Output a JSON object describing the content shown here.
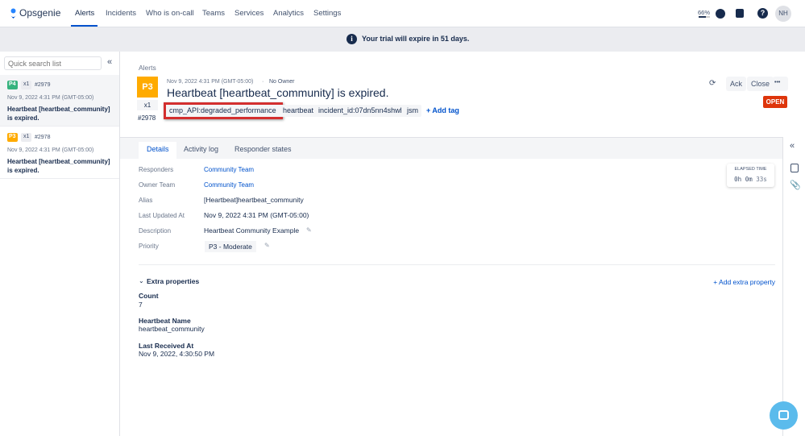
{
  "nav": {
    "brand": "Opsgenie",
    "items": [
      "Alerts",
      "Incidents",
      "Who is on-call",
      "Teams",
      "Services",
      "Analytics",
      "Settings"
    ],
    "progress_label": "66%",
    "avatar": "NH"
  },
  "banner": {
    "text": "Your trial will expire in 51 days."
  },
  "sidebar": {
    "search_placeholder": "Quick search list",
    "items": [
      {
        "priority": "P4",
        "count": "x1",
        "number": "#2979",
        "time": "Nov 9, 2022 4:31 PM (GMT-05:00)",
        "title": "Heartbeat [heartbeat_community] is expired.",
        "color": "#36b37e"
      },
      {
        "priority": "P3",
        "count": "x1",
        "number": "#2978",
        "time": "Nov 9, 2022 4:31 PM (GMT-05:00)",
        "title": "Heartbeat [heartbeat_community] is expired.",
        "color": "#ffab00"
      }
    ]
  },
  "alert": {
    "breadcrumb": "Alerts",
    "priority": "P3",
    "count": "x1",
    "number": "#2978",
    "time": "Nov 9, 2022 4:31 PM (GMT-05:00)",
    "owner": "No Owner",
    "title": "Heartbeat [heartbeat_community] is expired.",
    "tags": [
      "cmp_API:degraded_performance",
      "heartbeat",
      "incident_id:07dn5nn4shwl",
      "jsm"
    ],
    "add_tag": "+ Add tag",
    "ack": "Ack",
    "close": "Close",
    "more": "•••",
    "status": "OPEN"
  },
  "tabs": [
    "Details",
    "Activity log",
    "Responder states"
  ],
  "details": [
    {
      "label": "Responders",
      "value": "Community Team"
    },
    {
      "label": "Owner Team",
      "value": "Community Team"
    },
    {
      "label": "Alias",
      "value": "[Heartbeat]heartbeat_community"
    },
    {
      "label": "Last Updated At",
      "value": "Nov 9, 2022 4:31 PM (GMT-05:00)"
    },
    {
      "label": "Description",
      "value": "Heartbeat Community Example"
    },
    {
      "label": "Priority",
      "value": "P3 - Moderate"
    }
  ],
  "elapsed": {
    "label": "ELAPSED TIME",
    "h": "0h",
    "m": "0m",
    "s": "33s"
  },
  "extra": {
    "title": "Extra properties",
    "add": "+ Add extra property",
    "props": [
      {
        "name": "Count",
        "value": "7"
      },
      {
        "name": "Heartbeat Name",
        "value": "heartbeat_community"
      },
      {
        "name": "Last Received At",
        "value": "Nov 9, 2022, 4:30:50 PM"
      }
    ]
  }
}
